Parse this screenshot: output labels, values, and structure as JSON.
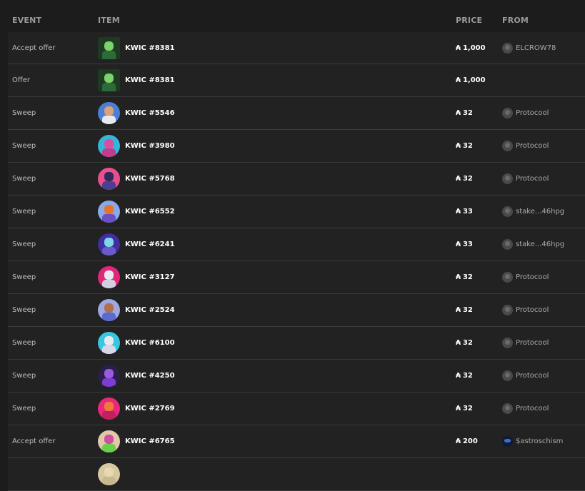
{
  "columns": {
    "event": "EVENT",
    "item": "ITEM",
    "price": "PRICE",
    "from": "FROM"
  },
  "currency_symbol": "₳",
  "rows": [
    {
      "event": "Accept offer",
      "item": "KWIC #8381",
      "price": "1,000",
      "from": "ELCROW78",
      "thumb": {
        "bg": "#1d3b22",
        "head": "#7bd36a",
        "body": "#2d6a39",
        "square": true
      },
      "from_avatar": "default"
    },
    {
      "event": "Offer",
      "item": "KWIC #8381",
      "price": "1,000",
      "from": "",
      "thumb": {
        "bg": "#1d3b22",
        "head": "#7bd36a",
        "body": "#2d6a39",
        "square": true
      },
      "from_avatar": "none"
    },
    {
      "event": "Sweep",
      "item": "KWIC #5546",
      "price": "32",
      "from": "Protocool",
      "thumb": {
        "bg": "#4a7fd4",
        "head": "#d9a07a",
        "body": "#e8e8f0",
        "square": false
      },
      "from_avatar": "default"
    },
    {
      "event": "Sweep",
      "item": "KWIC #3980",
      "price": "32",
      "from": "Protocool",
      "thumb": {
        "bg": "#35b5d8",
        "head": "#d94fa0",
        "body": "#c23b8d",
        "square": false
      },
      "from_avatar": "default"
    },
    {
      "event": "Sweep",
      "item": "KWIC #5768",
      "price": "32",
      "from": "Protocool",
      "thumb": {
        "bg": "#e74f8e",
        "head": "#2f2a5a",
        "body": "#4b3f8f",
        "square": false
      },
      "from_avatar": "default"
    },
    {
      "event": "Sweep",
      "item": "KWIC #6552",
      "price": "33",
      "from": "stake...46hpg",
      "thumb": {
        "bg": "#8aa9e8",
        "head": "#e8742a",
        "body": "#6a4fc7",
        "square": false
      },
      "from_avatar": "default"
    },
    {
      "event": "Sweep",
      "item": "KWIC #6241",
      "price": "33",
      "from": "stake...46hpg",
      "thumb": {
        "bg": "#3f2fa0",
        "head": "#7fd6e8",
        "body": "#6b5ac9",
        "square": false
      },
      "from_avatar": "default"
    },
    {
      "event": "Sweep",
      "item": "KWIC #3127",
      "price": "32",
      "from": "Protocool",
      "thumb": {
        "bg": "#e0287a",
        "head": "#e8e8f0",
        "body": "#d0d0e0",
        "square": false
      },
      "from_avatar": "default"
    },
    {
      "event": "Sweep",
      "item": "KWIC #2524",
      "price": "32",
      "from": "Protocool",
      "thumb": {
        "bg": "#9fa8e0",
        "head": "#b07050",
        "body": "#5a6ad0",
        "square": false
      },
      "from_avatar": "default"
    },
    {
      "event": "Sweep",
      "item": "KWIC #6100",
      "price": "32",
      "from": "Protocool",
      "thumb": {
        "bg": "#38c6e0",
        "head": "#e8e8f0",
        "body": "#d8d8e8",
        "square": false
      },
      "from_avatar": "default"
    },
    {
      "event": "Sweep",
      "item": "KWIC #4250",
      "price": "32",
      "from": "Protocool",
      "thumb": {
        "bg": "#2a1f4a",
        "head": "#9a5ae0",
        "body": "#7a3fd0",
        "square": false
      },
      "from_avatar": "default"
    },
    {
      "event": "Sweep",
      "item": "KWIC #2769",
      "price": "32",
      "from": "Protocool",
      "thumb": {
        "bg": "#e8287a",
        "head": "#f07a3a",
        "body": "#c02060",
        "square": false
      },
      "from_avatar": "default"
    },
    {
      "event": "Accept offer",
      "item": "KWIC #6765",
      "price": "200",
      "from": "$astroschism",
      "thumb": {
        "bg": "#e0c8a8",
        "head": "#d04fa0",
        "body": "#6ad04a",
        "square": false
      },
      "from_avatar": "astro"
    },
    {
      "event": "",
      "item": "",
      "price": "",
      "from": "",
      "thumb": {
        "bg": "#d8c8a0",
        "head": "#e8d8b0",
        "body": "#c8b890",
        "square": false
      },
      "from_avatar": "none"
    }
  ]
}
